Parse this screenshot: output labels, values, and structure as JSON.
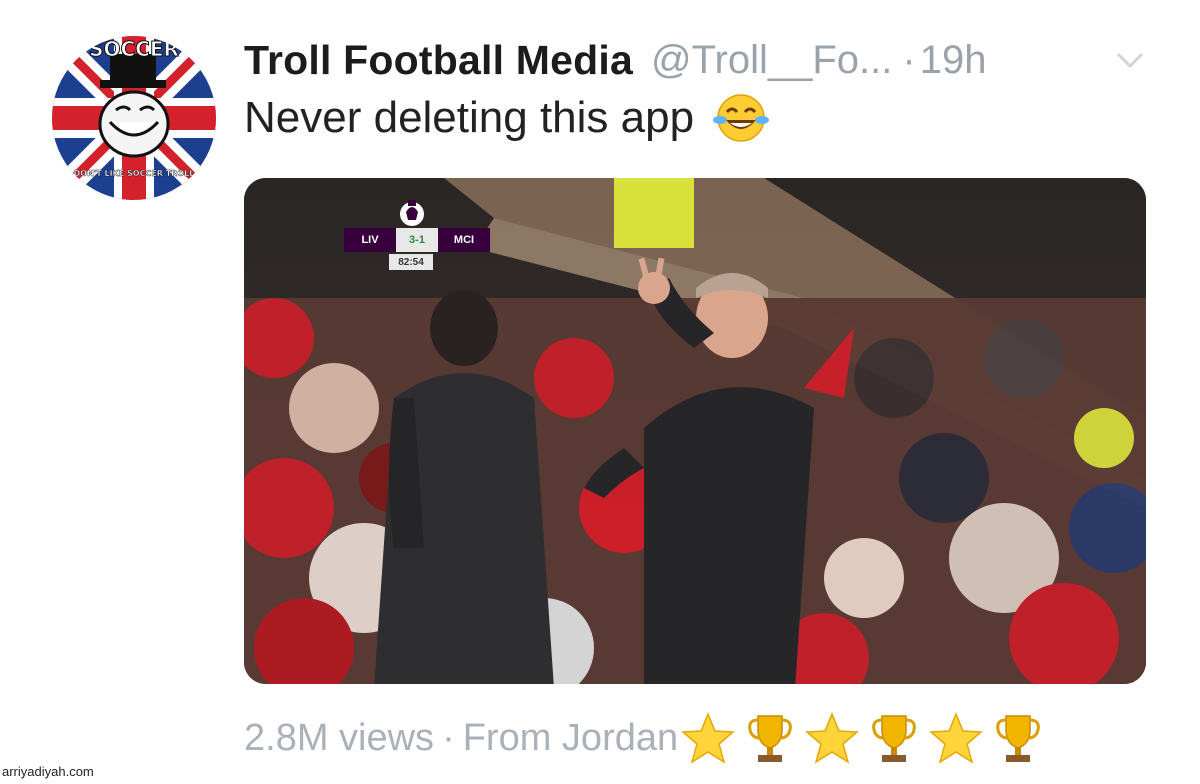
{
  "tweet": {
    "display_name": "Troll Football Media",
    "handle": "@Troll__Fo...",
    "separator": "·",
    "timestamp": "19h",
    "text": "Never deleting this app",
    "text_emoji": "face-with-tears-of-joy-icon",
    "avatar": {
      "top_text": "SOCCER",
      "bottom_text": "DON'T LIKE SOCCER TROLL"
    },
    "menu_icon": "chevron-down-icon"
  },
  "media": {
    "scorebug": {
      "home": "LIV",
      "score": "3-1",
      "away": "MCI",
      "clock": "82:54"
    }
  },
  "footer": {
    "views": "2.8M views",
    "separator": "·",
    "location": "From Jordan",
    "emojis": [
      "star-icon",
      "trophy-icon",
      "star-icon",
      "trophy-icon",
      "star-icon",
      "trophy-icon"
    ]
  },
  "watermark": "arriyadiyah.com",
  "colors": {
    "secondary_text": "#aab1b8",
    "premier_league_purple": "#37003c",
    "crowd_red": "#c8202a"
  }
}
